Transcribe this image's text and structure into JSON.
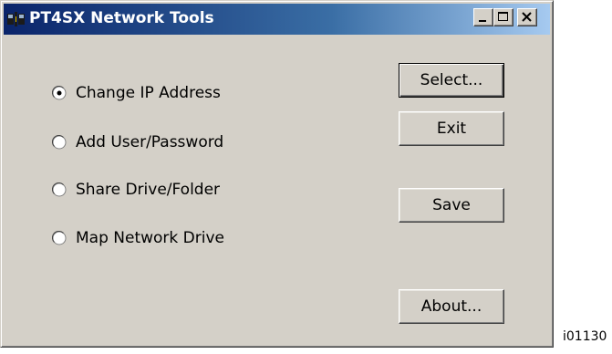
{
  "window": {
    "title": "PT4SX Network Tools",
    "app_icon": "network-tools-icon",
    "controls": {
      "minimize_icon": "minimize-icon",
      "maximize_icon": "maximize-icon",
      "close_icon": "close-icon"
    }
  },
  "options": {
    "selected": "Change IP Address",
    "items": [
      {
        "label": "Change IP Address",
        "checked": true
      },
      {
        "label": "Add User/Password",
        "checked": false
      },
      {
        "label": "Share Drive/Folder",
        "checked": false
      },
      {
        "label": "Map Network Drive",
        "checked": false
      }
    ]
  },
  "buttons": {
    "select": "Select...",
    "exit": "Exit",
    "save": "Save",
    "about": "About..."
  },
  "figure_id": "i01130",
  "colors": {
    "title_gradient_start": "#0a246a",
    "title_gradient_end": "#a6caf0",
    "face": "#d4d0c8"
  }
}
